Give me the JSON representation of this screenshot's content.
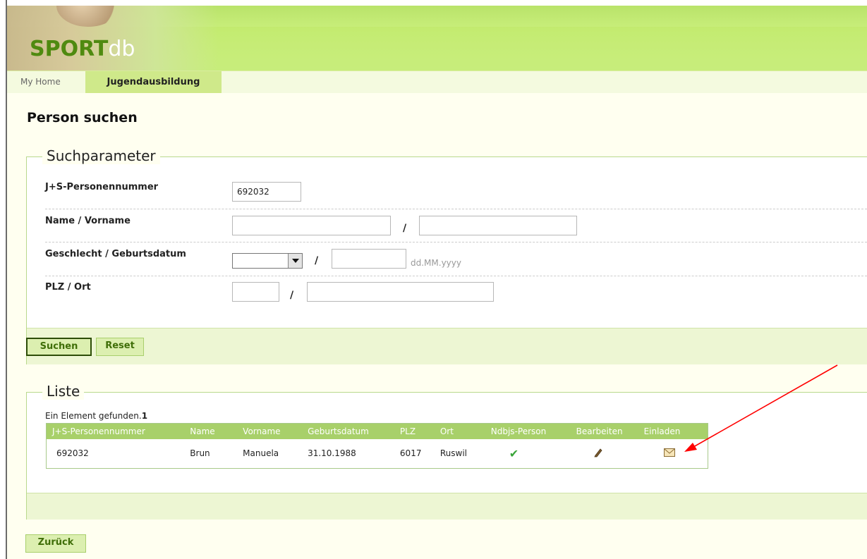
{
  "app": {
    "logo_main": "SPORT",
    "logo_suffix": "db"
  },
  "nav": {
    "tabs": [
      {
        "label": "My Home"
      },
      {
        "label": "Jugendausbildung"
      }
    ]
  },
  "page": {
    "title": "Person suchen"
  },
  "search": {
    "legend": "Suchparameter",
    "js_label": "J+S-Personennummer",
    "js_value": "692032",
    "name_label": "Name / Vorname",
    "name_value": "",
    "vorname_value": "",
    "gender_label": "Geschlecht / Geburtsdatum",
    "gender_value": "",
    "birthdate_value": "",
    "birthdate_hint": "dd.MM.yyyy",
    "plz_label": "PLZ / Ort",
    "plz_value": "",
    "ort_value": "",
    "slash": "/",
    "search_button": "Suchen",
    "reset_button": "Reset"
  },
  "list": {
    "legend": "Liste",
    "found_text": "Ein Element gefunden.",
    "found_count": "1",
    "columns": [
      "J+S-Personennummer",
      "Name",
      "Vorname",
      "Geburtsdatum",
      "PLZ",
      "Ort",
      "Ndbjs-Person",
      "Bearbeiten",
      "Einladen"
    ],
    "rows": [
      {
        "js": "692032",
        "name": "Brun",
        "vorname": "Manuela",
        "geburtsdatum": "31.10.1988",
        "plz": "6017",
        "ort": "Ruswil",
        "ndbjs_icon": "check-icon",
        "edit_icon": "pencil-icon",
        "invite_icon": "envelope-icon"
      }
    ]
  },
  "footer": {
    "back_button": "Zurück"
  },
  "colors": {
    "accent_green": "#a8d06a",
    "header_green": "#c8ee7a",
    "button_text": "#3f6e08",
    "annotation_arrow": "#ff0000"
  }
}
